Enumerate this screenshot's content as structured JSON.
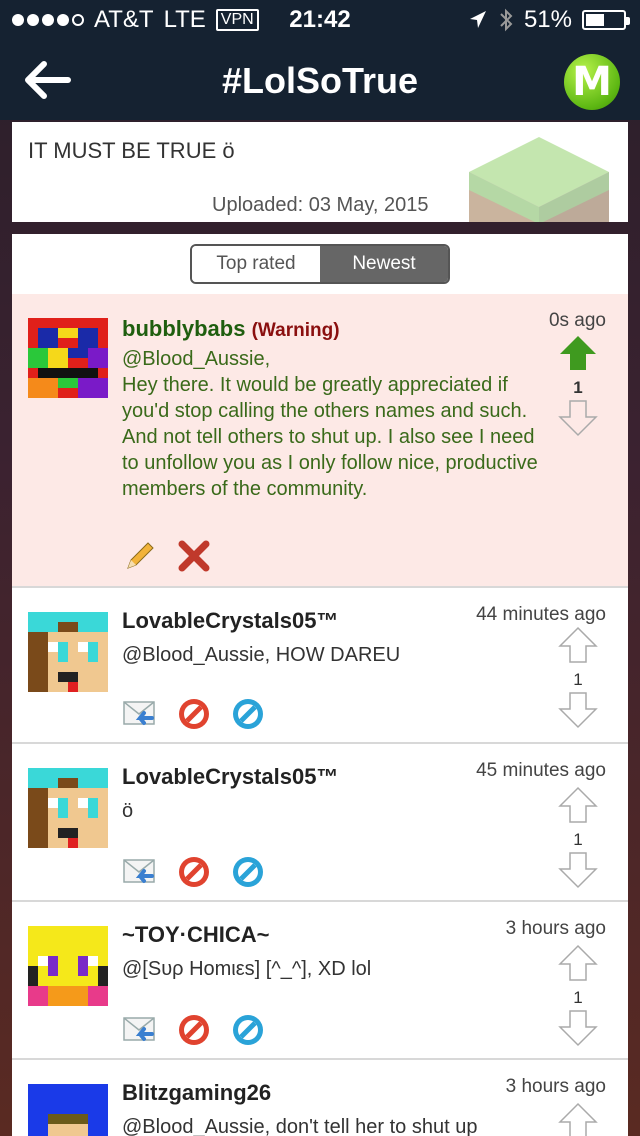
{
  "status_bar": {
    "carrier": "AT&T",
    "network": "LTE",
    "vpn": "VPN",
    "time": "21:42",
    "battery": "51%",
    "battery_level": 0.51,
    "signal_bars": 4
  },
  "nav": {
    "title": "#LolSoTrue",
    "back_icon": "back-arrow-icon",
    "logo_letter": "M"
  },
  "post": {
    "text": "IT MUST BE TRUE ö",
    "uploaded": "Uploaded: 03 May, 2015"
  },
  "sort_tabs": [
    {
      "label": "Top rated",
      "active": false
    },
    {
      "label": "Newest",
      "active": true
    }
  ],
  "comments": [
    {
      "user": "bubblybabs",
      "tag": "(Warning)",
      "time": "0s ago",
      "text": "@Blood_Aussie,\nHey there. It would be greatly appreciated if you'd stop calling the others names and such. And not tell others to shut up. I also see I need to unfollow you as I only follow nice, productive members of the community.",
      "votes": "1"
    },
    {
      "user": "LovableCrystals05™",
      "time": "44 minutes ago",
      "text": "@Blood_Aussie, HOW DAREU",
      "votes": "1"
    },
    {
      "user": "LovableCrystals05™",
      "time": "45 minutes ago",
      "text": "ö",
      "votes": "1"
    },
    {
      "user": "~TOY·CHICA~",
      "time": "3 hours ago",
      "text": "@[Sυρ Homιεs] [^_^], XD lol",
      "votes": "1"
    },
    {
      "user": "Blitzgaming26",
      "time": "3 hours ago",
      "text": "@Blood_Aussie, don't tell her to shut up"
    }
  ],
  "colors": {
    "navbar": "#152231",
    "warning_bg": "#fde9e6",
    "upvote_active": "#3f9a1f",
    "reply_blue": "#3a7fd0",
    "block_red": "#e0432f",
    "block_blue": "#2aa3d8"
  }
}
